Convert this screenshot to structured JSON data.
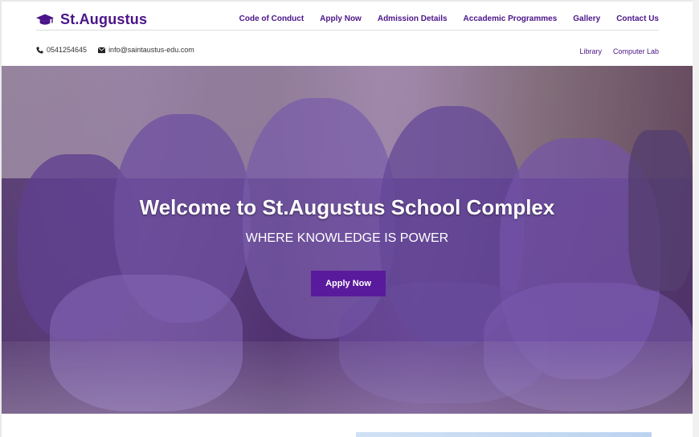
{
  "brand": {
    "name": "St.Augustus",
    "icon": "graduation-cap-icon",
    "color": "#4b1488"
  },
  "nav": {
    "items": [
      {
        "label": "Code of Conduct"
      },
      {
        "label": "Apply Now"
      },
      {
        "label": "Admission Details"
      },
      {
        "label": "Accademic Programmes"
      },
      {
        "label": "Gallery"
      },
      {
        "label": "Contact Us"
      }
    ]
  },
  "contact": {
    "phone": "0541254645",
    "phone_icon": "phone-icon",
    "email": "info@saintaustus-edu.com",
    "email_icon": "envelope-icon"
  },
  "subnav": {
    "items": [
      {
        "label": "Library"
      },
      {
        "label": "Computer Lab"
      }
    ]
  },
  "hero": {
    "title": "Welcome to St.Augustus School Complex",
    "subtitle": "WHERE KNOWLEDGE IS POWER",
    "button_label": "Apply Now",
    "button_color": "#5a1a9c"
  }
}
